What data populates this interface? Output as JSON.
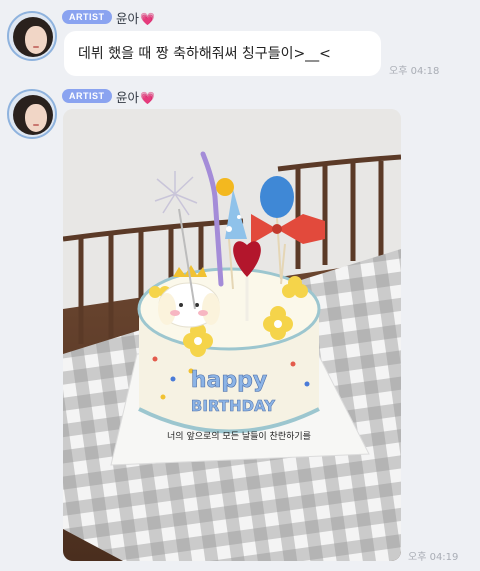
{
  "messages": [
    {
      "sender": "윤아",
      "badge": "ARTIST",
      "text": "데뷔 했을 때 짱 축하해줘써 칭구들이>__<",
      "time": "오후 04:18"
    },
    {
      "sender": "윤아",
      "badge": "ARTIST",
      "image_desc": "",
      "cake_text_top": "happy",
      "cake_text_mid": "BIRTHDAY",
      "cake_text_bottom": "너의 앞으로의 모든 날들이 찬란하기를",
      "time": "오후 04:19"
    }
  ],
  "icons": {
    "heart": "pink-heart-emoji"
  },
  "colors": {
    "badge": "#8aa3f0",
    "background": "#eef0f4",
    "bubble": "#ffffff",
    "time": "#a9adb5"
  }
}
